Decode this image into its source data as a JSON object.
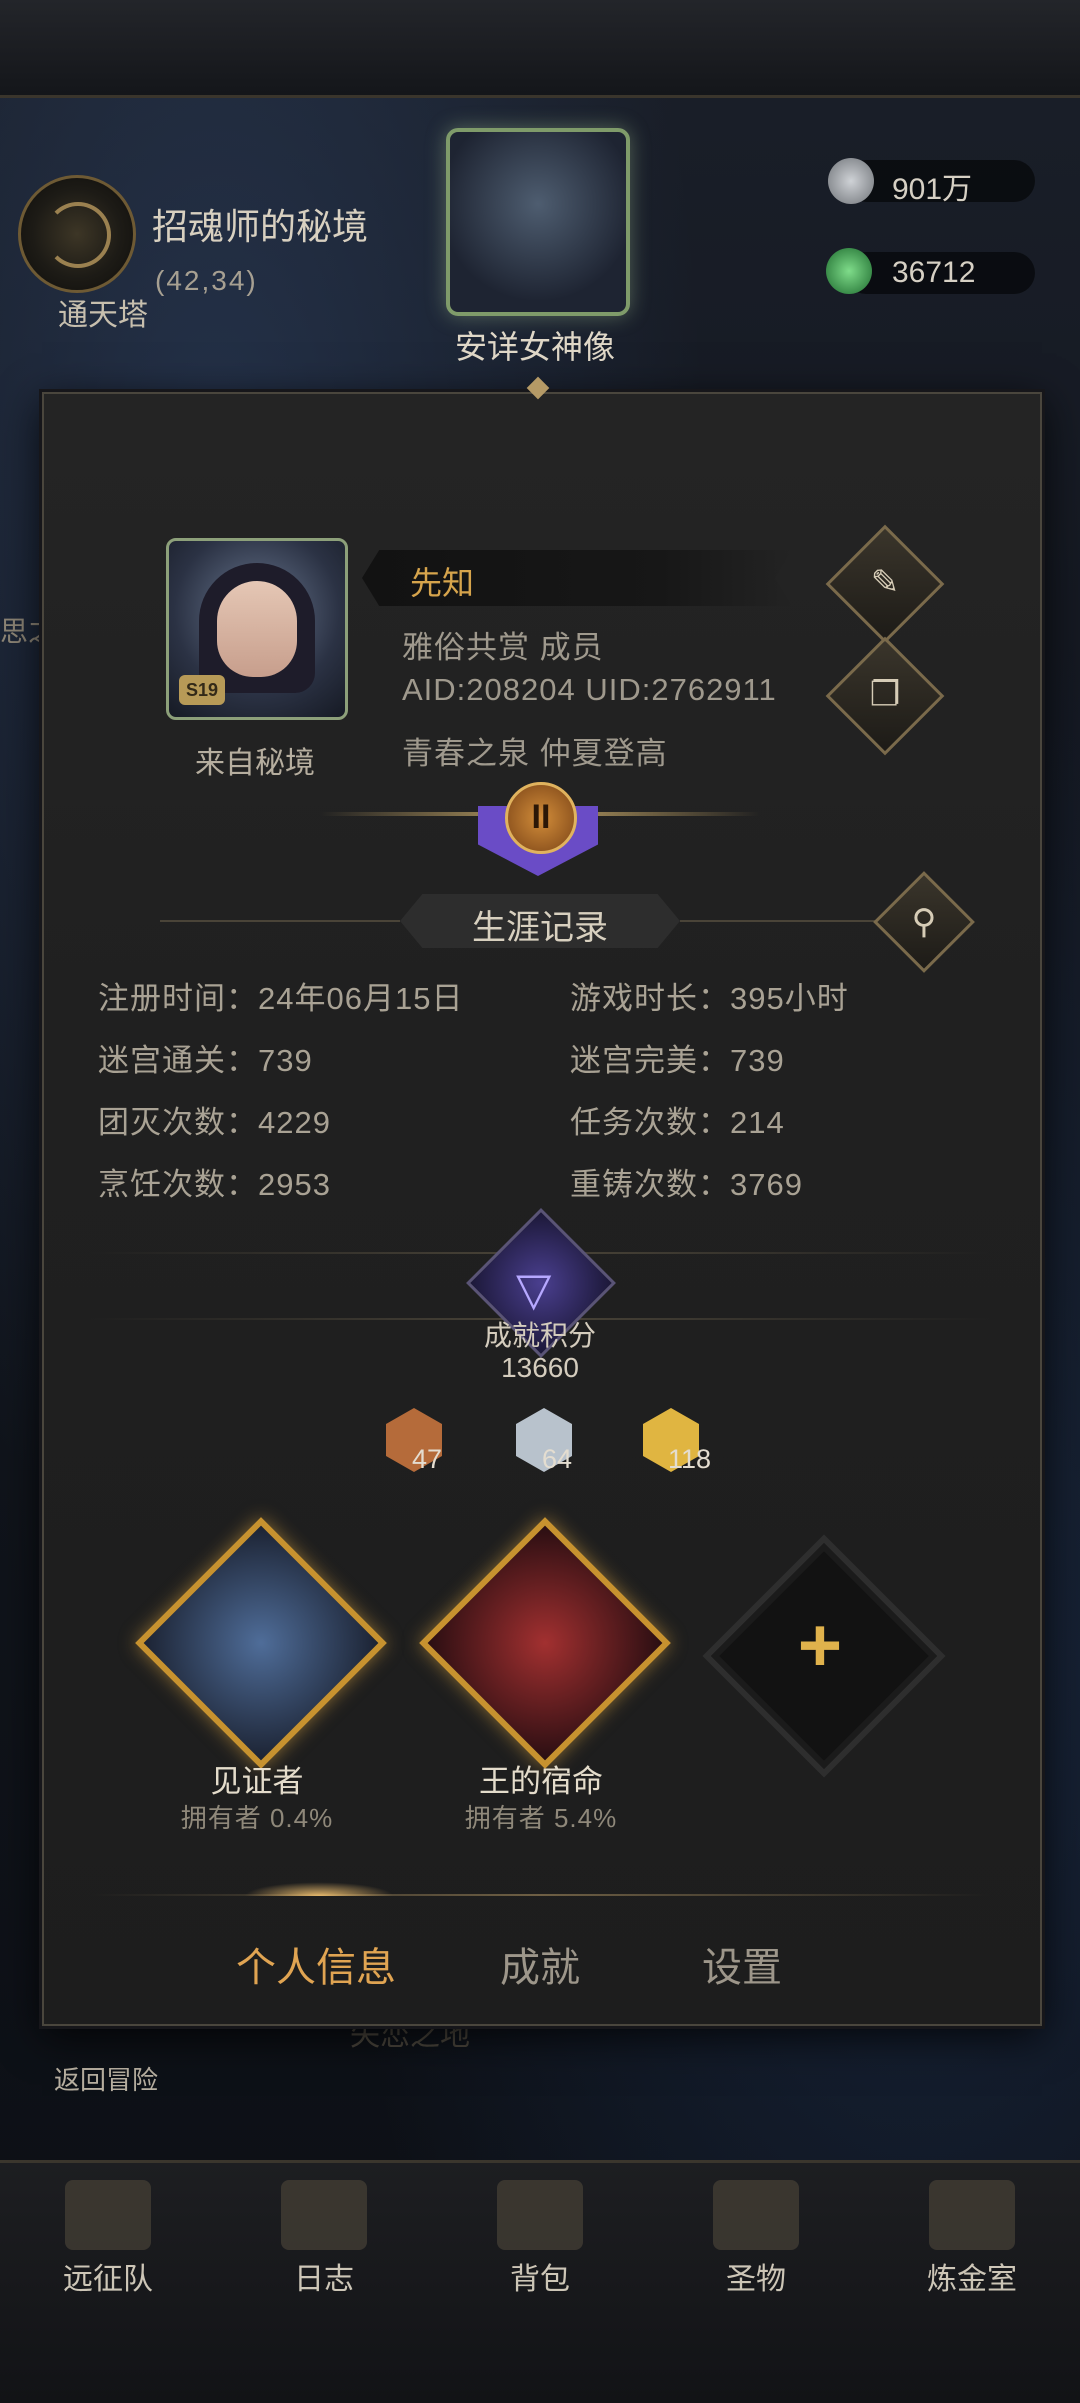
{
  "background": {
    "location_name": "招魂师的秘境",
    "location_coords": "(42,34)",
    "tower_label": "通天塔",
    "statue_label": "安详女神像",
    "statue_level": "S19",
    "left_edge_text": "思之",
    "resources": [
      {
        "icon": "silver-coin-icon",
        "value": "901万"
      },
      {
        "icon": "green-gem-icon",
        "value": "36712"
      }
    ],
    "back_label": "返回冒险",
    "under_label": "失恋之地"
  },
  "bottom_nav": [
    {
      "label": "远征队",
      "icon": "horned-helmet-icon"
    },
    {
      "label": "日志",
      "icon": "journal-icon"
    },
    {
      "label": "背包",
      "icon": "backpack-icon"
    },
    {
      "label": "圣物",
      "icon": "relic-icon"
    },
    {
      "label": "炼金室",
      "icon": "alchemy-icon"
    }
  ],
  "profile": {
    "title": "先知",
    "guild_line": "雅俗共赏  成员",
    "id_line": "AID:208204 UID:2762911",
    "tags_line": "青春之泉  仲夏登高",
    "avatar_level": "S19",
    "avatar_caption": "来自秘境",
    "rank_numeral": "II"
  },
  "career": {
    "title": "生涯记录",
    "stats": [
      {
        "text": "注册时间：24年06月15日"
      },
      {
        "text": "游戏时长：395小时"
      },
      {
        "text": "迷宫通关：739"
      },
      {
        "text": "迷宫完美：739"
      },
      {
        "text": "团灭次数：4229"
      },
      {
        "text": "任务次数：214"
      },
      {
        "text": "烹饪次数：2953"
      },
      {
        "text": "重铸次数：3769"
      }
    ]
  },
  "achievements": {
    "label": "成就积分",
    "score": "13660",
    "medals": [
      {
        "tier": "bronze",
        "count": "47",
        "color": "#b56b3a"
      },
      {
        "tier": "silver",
        "count": "64",
        "color": "#b8c2cc"
      },
      {
        "tier": "gold",
        "count": "118",
        "color": "#e0b541"
      }
    ],
    "badges": [
      {
        "name": "见证者",
        "owners": "拥有者  0.4%"
      },
      {
        "name": "王的宿命",
        "owners": "拥有者  5.4%"
      }
    ],
    "add_symbol": "+"
  },
  "tabs": [
    {
      "label": "个人信息",
      "active": true
    },
    {
      "label": "成就",
      "active": false
    },
    {
      "label": "设置",
      "active": false
    }
  ],
  "colors": {
    "accent_gold": "#e0a452",
    "title_gold": "#d6a44c",
    "panel_bg": "#222222"
  }
}
